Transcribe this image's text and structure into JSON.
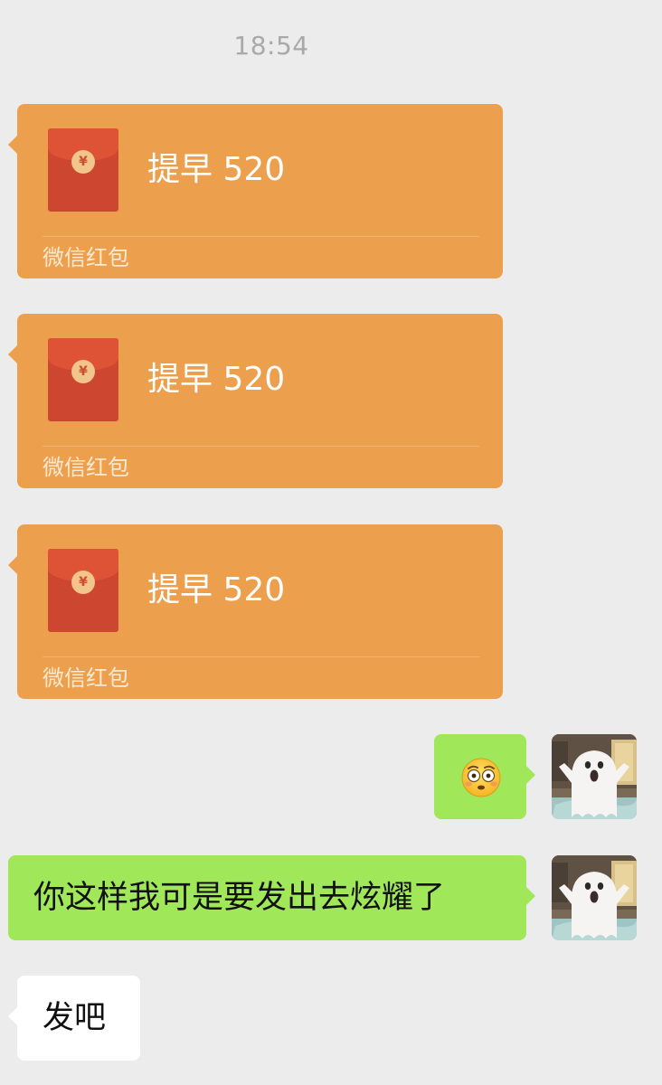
{
  "chat": {
    "timestamp": "18:54",
    "red_envelopes": [
      {
        "title": "提早 520",
        "label": "微信红包",
        "currency_symbol": "¥"
      },
      {
        "title": "提早 520",
        "label": "微信红包",
        "currency_symbol": "¥"
      },
      {
        "title": "提早 520",
        "label": "微信红包",
        "currency_symbol": "¥"
      }
    ],
    "outgoing_messages": [
      {
        "emoji": "flushed-face-emoji"
      },
      {
        "text": "你这样我可是要发出去炫耀了"
      }
    ],
    "incoming_reply": {
      "text": "发吧"
    },
    "avatar": {
      "icon": "ghost-avatar"
    }
  },
  "colors": {
    "background": "#ececec",
    "envelope_bubble": "#eca04d",
    "envelope_red": "#cc4630",
    "outgoing_bubble": "#a0e75a",
    "incoming_bubble": "#ffffff",
    "timestamp_text": "#a9a9a9"
  }
}
